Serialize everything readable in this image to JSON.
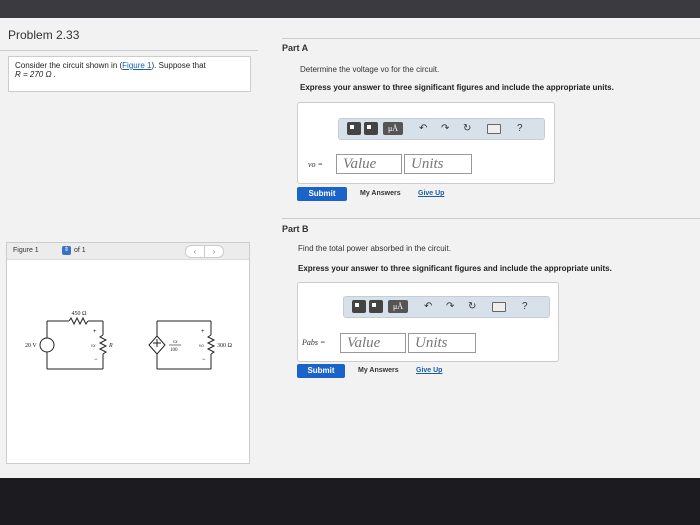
{
  "problem": {
    "title": "Problem 2.33",
    "intro_text": "Consider the circuit shown in (",
    "intro_link": "Figure 1",
    "intro_after": "). Suppose that",
    "intro_line2": "R = 270  Ω ."
  },
  "figure": {
    "label": "Figure 1",
    "of_text": "of 1",
    "prev": "‹",
    "next": "›",
    "circuit": {
      "r_top": "450 Ω",
      "source_v": "20 V",
      "r_label": "R",
      "vx_label": "vx",
      "plus": "+",
      "minus": "−",
      "dep_source": "vx",
      "dep_div": "100",
      "vo_label": "vo",
      "r_right": "300 Ω"
    }
  },
  "partA": {
    "title": "Part A",
    "question": "Determine the voltage vo for the circuit.",
    "instruction": "Express your answer to three significant figures and include the appropriate units.",
    "var_label": "vo =",
    "value_placeholder": "Value",
    "units_placeholder": "Units",
    "submit": "Submit",
    "my_answers": "My Answers",
    "give_up": "Give Up"
  },
  "partB": {
    "title": "Part B",
    "question": "Find the total power absorbed in the circuit.",
    "instruction": "Express your answer to three significant figures and include the appropriate units.",
    "var_label": "Pabs =",
    "value_placeholder": "Value",
    "units_placeholder": "Units",
    "submit": "Submit",
    "my_answers": "My Answers",
    "give_up": "Give Up"
  },
  "toolbar": {
    "mu_label": "μÅ",
    "undo_icon": "↶",
    "redo_icon": "↷",
    "reset_icon": "↻",
    "help_icon": "?"
  }
}
